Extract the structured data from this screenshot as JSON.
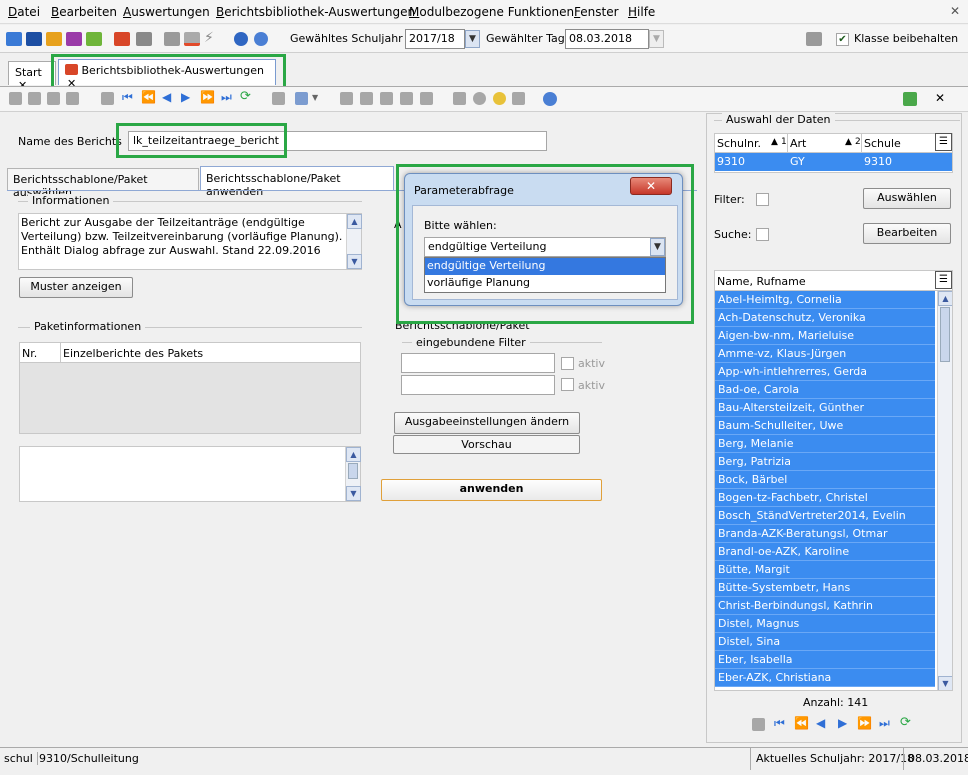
{
  "menu": [
    "Datei",
    "Bearbeiten",
    "Auswertungen",
    "Berichtsbibliothek-Auswertungen",
    "Modulbezogene Funktionen",
    "Fenster",
    "Hilfe"
  ],
  "toolbar": {
    "schuljahr_label": "Gewähltes Schuljahr",
    "schuljahr_value": "2017/18",
    "tag_label": "Gewählter Tag",
    "tag_value": "08.03.2018",
    "klasse_label": "Klasse beibehalten"
  },
  "tabs": {
    "start": "Start",
    "active": "Berichtsbibliothek-Auswertungen"
  },
  "report": {
    "name_label": "Name des Berichts",
    "name_value": "lk_teilzeitantraege_bericht",
    "subtab1": "Berichtsschablone/Paket auswählen",
    "subtab2": "Berichtsschablone/Paket anwenden",
    "info_title": "Informationen",
    "info_text": "Bericht zur Ausgabe der Teilzeitanträge (endgültige Verteilung) bzw. Teilzeitvereinbarung (vorläufige Planung). Enthält Dialog abfrage zur Auswahl. Stand 22.09.2016",
    "muster_button": "Muster anzeigen",
    "paket_title": "Paketinformationen",
    "paket_col1": "Nr.",
    "paket_col2": "Einzelberichte des Pakets",
    "right_group_title": "Berichtsschablone/Paket",
    "filter_title": "eingebundene Filter",
    "aktiv1": "aktiv",
    "aktiv2": "aktiv",
    "ausgabe_button": "Ausgabeeinstellungen ändern",
    "vorschau_button": "Vorschau",
    "anwenden_button": "anwenden",
    "hidden_a": "A"
  },
  "dialog": {
    "title": "Parameterabfrage",
    "prompt": "Bitte wählen:",
    "selected": "endgültige Verteilung",
    "options": [
      "endgültige Verteilung",
      "vorläufige Planung"
    ]
  },
  "data_panel": {
    "title": "Auswahl der Daten",
    "columns": [
      "Schulnr.",
      "Art",
      "Schule"
    ],
    "col_sort": [
      "1",
      "2"
    ],
    "row": [
      "9310",
      "GY",
      "9310"
    ],
    "filter_label": "Filter:",
    "suche_label": "Suche:",
    "auswaehlen_button": "Auswählen",
    "bearbeiten_button": "Bearbeiten",
    "names_header": "Name, Rufname",
    "names": [
      "Abel-Heimltg, Cornelia",
      "Ach-Datenschutz, Veronika",
      "Aigen-bw-nm, Marieluise",
      "Amme-vz, Klaus-Jürgen",
      "App-wh-intlehrerres, Gerda",
      "Bad-oe, Carola",
      "Bau-Altersteilzeit, Günther",
      "Baum-Schulleiter, Uwe",
      "Berg, Melanie",
      "Berg, Patrizia",
      "Bock, Bärbel",
      "Bogen-tz-Fachbetr, Christel",
      "Bosch_StändVertreter2014, Evelin",
      "Branda-AZK-Beratungsl, Otmar",
      "Brandl-oe-AZK, Karoline",
      "Bütte, Margit",
      "Bütte-Systembetr, Hans",
      "Christ-Berbindungsl, Kathrin",
      "Distel, Magnus",
      "Distel, Sina",
      "Eber, Isabella",
      "Eber-AZK, Christiana"
    ],
    "count_label": "Anzahl: 141"
  },
  "status": {
    "left1": "schul",
    "left2": "9310/Schulleitung",
    "right1": "Aktuelles Schuljahr: 2017/18",
    "right2": "08.03.2018"
  }
}
